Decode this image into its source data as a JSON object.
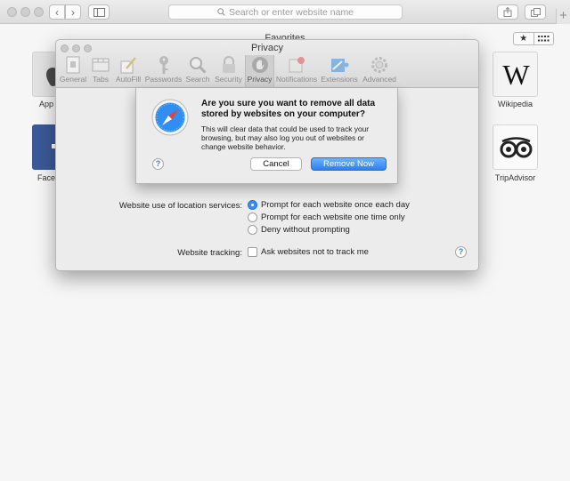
{
  "browser": {
    "address_placeholder": "Search or enter website name",
    "favorites_title": "Favorites"
  },
  "favorites": {
    "left_labels": [
      "App",
      "Facel"
    ],
    "right_labels": [
      "Wikipedia",
      "TripAdvisor"
    ]
  },
  "prefs": {
    "title": "Privacy",
    "tabs": [
      {
        "label": "General",
        "icon": "general-icon"
      },
      {
        "label": "Tabs",
        "icon": "tabs-icon"
      },
      {
        "label": "AutoFill",
        "icon": "autofill-icon"
      },
      {
        "label": "Passwords",
        "icon": "key-icon"
      },
      {
        "label": "Search",
        "icon": "magnifier-icon"
      },
      {
        "label": "Security",
        "icon": "lock-icon"
      },
      {
        "label": "Privacy",
        "icon": "hand-icon"
      },
      {
        "label": "Notifications",
        "icon": "notifications-icon"
      },
      {
        "label": "Extensions",
        "icon": "puzzle-icon"
      },
      {
        "label": "Advanced",
        "icon": "gear-icon"
      }
    ],
    "selected_tab": "Privacy",
    "location_label": "Website use of location services:",
    "location_options": [
      "Prompt for each website once each day",
      "Prompt for each website one time only",
      "Deny without prompting"
    ],
    "location_selected_index": 0,
    "tracking_label": "Website tracking:",
    "tracking_option": "Ask websites not to track me",
    "tracking_checked": false
  },
  "alert": {
    "title": "Are you sure you want to remove all data stored by websites on your computer?",
    "body": "This will clear data that could be used to track your browsing, but may also log you out of websites or change website behavior.",
    "cancel_label": "Cancel",
    "confirm_label": "Remove Now",
    "help_glyph": "?"
  },
  "colors": {
    "accent": "#3c8cf0",
    "primary_button": "#2d7ff0"
  }
}
